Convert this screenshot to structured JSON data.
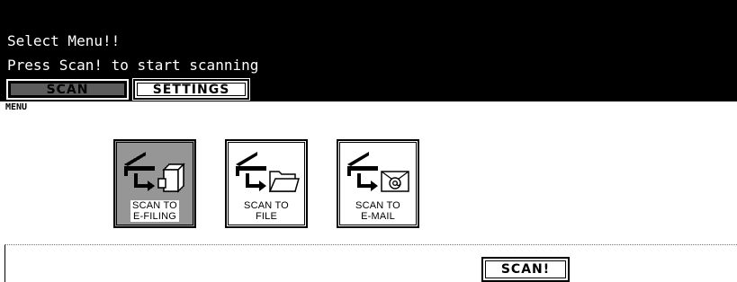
{
  "header": {
    "line1": "Select Menu!!",
    "line2": "Press Scan! to start scanning"
  },
  "tabs": [
    {
      "label": "SCAN",
      "active": true
    },
    {
      "label": "SETTINGS",
      "active": false
    }
  ],
  "menu_label": "MENU",
  "menu_buttons": [
    {
      "line1": "SCAN TO",
      "line2": "E-FILING",
      "icon": "scan-to-efiling-icon",
      "selected": true
    },
    {
      "line1": "SCAN TO",
      "line2": "FILE",
      "icon": "scan-to-file-icon",
      "selected": false
    },
    {
      "line1": "SCAN TO",
      "line2": "E-MAIL",
      "icon": "scan-to-email-icon",
      "selected": false
    }
  ],
  "scan_button": "SCAN!",
  "colors": {
    "header_bg": "#000000",
    "header_text": "#ffffff",
    "page_bg": "#ffffff"
  }
}
